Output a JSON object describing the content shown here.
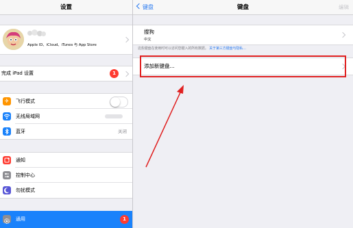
{
  "left": {
    "title": "设置",
    "profile": {
      "name": "",
      "subtitle": "Apple ID、iCloud、iTunes 与 App Store"
    },
    "setup": {
      "label": "完成 iPad 设置",
      "badge": "1"
    },
    "group1": [
      {
        "label": "飞行模式",
        "icon": "airplane-icon",
        "icon_color": "#ff9500",
        "value": "",
        "toggle": false
      },
      {
        "label": "无线局域网",
        "icon": "wifi-icon",
        "icon_color": "#1a82fb",
        "value": ""
      },
      {
        "label": "蓝牙",
        "icon": "bluetooth-icon",
        "icon_color": "#1a82fb",
        "value": "关闭"
      }
    ],
    "group2": [
      {
        "label": "通知",
        "icon": "notifications-icon",
        "icon_color": "#ff3b30"
      },
      {
        "label": "控制中心",
        "icon": "control-center-icon",
        "icon_color": "#8e8e93"
      },
      {
        "label": "勿扰模式",
        "icon": "moon-icon",
        "icon_color": "#5856d6"
      }
    ],
    "general": {
      "label": "通用",
      "icon": "gear-icon",
      "icon_color": "#8e8e93",
      "badge": "1",
      "selected_color": "#1a82fb"
    }
  },
  "right": {
    "back_label": "键盘",
    "title": "键盘",
    "edit_label": "编辑",
    "keyboard": {
      "name": "搜狗",
      "subtitle": "中文"
    },
    "privacy_text": "这些键盘在使用时可以访问您键入的所有数据。",
    "privacy_link": "关于第三方键盘与隐私…",
    "add_keyboard": "添加新键盘..."
  },
  "colors": {
    "accent": "#2b7bf0",
    "highlight": "#e02020"
  }
}
